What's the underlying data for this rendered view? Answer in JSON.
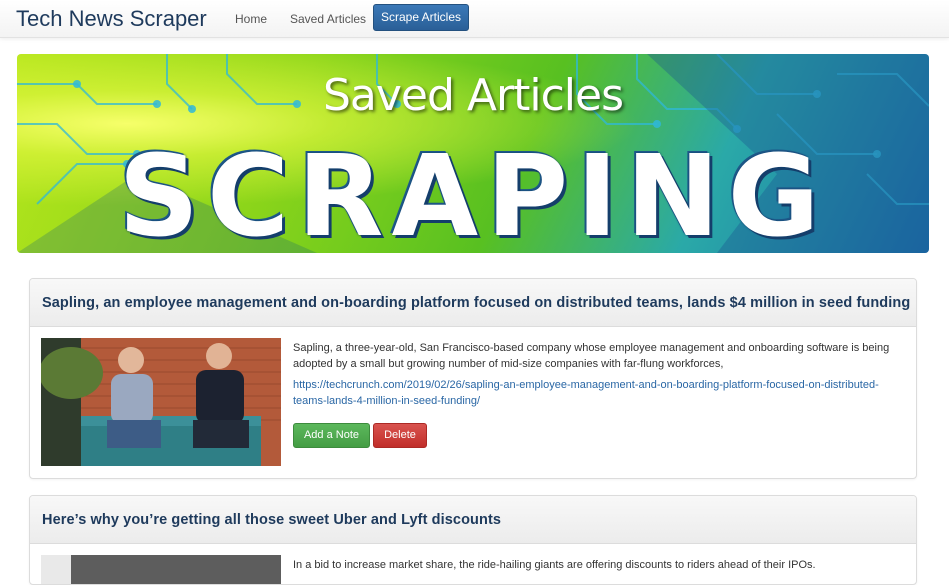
{
  "navbar": {
    "brand": "Tech News Scraper",
    "links": {
      "home": "Home",
      "saved": "Saved Articles",
      "scrape": "Scrape Articles"
    }
  },
  "banner": {
    "title": "Saved Articles",
    "word": "SCRAPING"
  },
  "articles": [
    {
      "title": "Sapling, an employee management and on-boarding platform focused on distributed teams, lands $4 million in seed funding",
      "summary": "Sapling, a three-year-old, San Francisco-based company whose employee management and onboarding software is being adopted by a small but growing number of mid-size companies with far-flung workforces,",
      "link": "https://techcrunch.com/2019/02/26/sapling-an-employee-management-and-on-boarding-platform-focused-on-distributed-teams-lands-4-million-in-seed-funding/",
      "note_label": "Add a Note",
      "delete_label": "Delete"
    },
    {
      "title": "Here’s why you’re getting all those sweet Uber and Lyft discounts",
      "summary": "In a bid to increase market share, the ride-hailing giants are offering discounts to riders ahead of their IPOs."
    }
  ],
  "colors": {
    "brand": "#1e3a5c",
    "primary_button": "#2a5f97",
    "success_button": "#449d44",
    "danger_button": "#c12e2a",
    "link": "#2a67a5"
  }
}
